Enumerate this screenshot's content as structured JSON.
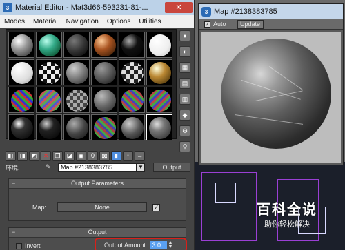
{
  "material_editor": {
    "title": "Material Editor - Mat3d66-593231-81-...",
    "close_label": "✕",
    "menu": [
      "Modes",
      "Material",
      "Navigation",
      "Options",
      "Utilities"
    ],
    "name_label": "环境:",
    "map_name": "Map #2138383785",
    "type_button": "Output"
  },
  "output_parameters": {
    "header": "Output Parameters",
    "map_label": "Map:",
    "map_button": "None"
  },
  "output_rollout": {
    "header": "Output",
    "invert_label": "Invert",
    "amount_label": "Output Amount:",
    "amount_value": "3.0"
  },
  "map_window": {
    "title": "Map #2138383785",
    "auto_label": "Auto",
    "update_label": "Update"
  },
  "watermark": {
    "title": "百科全说",
    "subtitle": "助你轻松解决"
  },
  "colors": {
    "accent_highlight": "#d8201a",
    "value_field": "#5aa0f0"
  }
}
